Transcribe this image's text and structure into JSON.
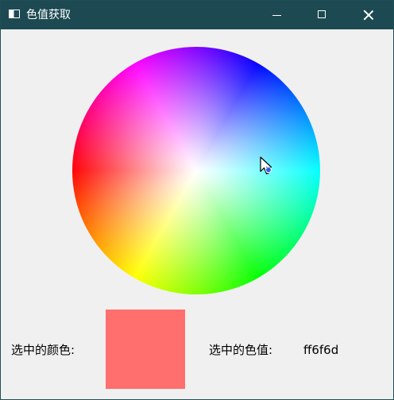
{
  "window": {
    "title": "色值获取",
    "titlebar_color": "#1d4a52",
    "controls": [
      "minimize-icon",
      "maximize-icon",
      "close-icon"
    ]
  },
  "color_wheel": {
    "type": "hue-saturation-wheel"
  },
  "selection": {
    "color_label": "选中的颜色:",
    "swatch_color": "#ff6f6d",
    "value_label": "选中的色值:",
    "hex_value": "ff6f6d"
  }
}
